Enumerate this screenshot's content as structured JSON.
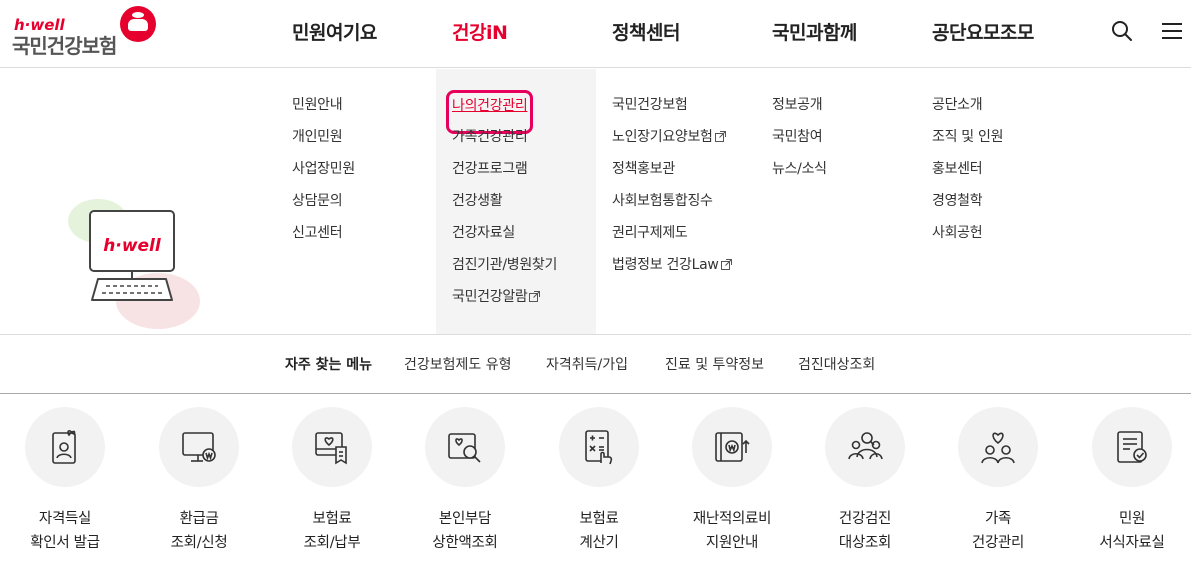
{
  "logo": {
    "hwell": "h·well",
    "text": "국민건강보험"
  },
  "gnb": [
    {
      "label": "민원여기요"
    },
    {
      "label": "건강iN"
    },
    {
      "label": "정책센터"
    },
    {
      "label": "국민과함께"
    },
    {
      "label": "공단요모조모"
    }
  ],
  "mega": {
    "col1": [
      "민원안내",
      "개인민원",
      "사업장민원",
      "상담문의",
      "신고센터"
    ],
    "col2": [
      "나의건강관리",
      "가족건강관리",
      "건강프로그램",
      "건강생활",
      "건강자료실",
      "검진기관/병원찾기",
      "국민건강알람"
    ],
    "col3": [
      "국민건강보험",
      "노인장기요양보험",
      "정책홍보관",
      "사회보험통합징수",
      "권리구제제도",
      "법령정보 건강Law"
    ],
    "col4": [
      "정보공개",
      "국민참여",
      "뉴스/소식"
    ],
    "col5": [
      "공단소개",
      "조직 및 인원",
      "홍보센터",
      "경영철학",
      "사회공헌"
    ],
    "illustration_text": "h·well"
  },
  "frequent": {
    "title": "자주 찾는 메뉴",
    "links": [
      "건강보험제도 유형",
      "자격취득/가입",
      "진료 및 투약정보",
      "검진대상조회"
    ]
  },
  "quick": [
    {
      "line1": "자격득실",
      "line2": "확인서 발급",
      "icon": "certificate-icon"
    },
    {
      "line1": "환급금",
      "line2": "조회/신청",
      "icon": "refund-monitor-icon"
    },
    {
      "line1": "보험료",
      "line2": "조회/납부",
      "icon": "premium-payment-icon"
    },
    {
      "line1": "본인부담",
      "line2": "상한액조회",
      "icon": "search-heart-icon"
    },
    {
      "line1": "보험료",
      "line2": "계산기",
      "icon": "calculator-icon"
    },
    {
      "line1": "재난적의료비",
      "line2": "지원안내",
      "icon": "medical-support-icon"
    },
    {
      "line1": "건강검진",
      "line2": "대상조회",
      "icon": "checkup-people-icon"
    },
    {
      "line1": "가족",
      "line2": "건강관리",
      "icon": "family-health-icon"
    },
    {
      "line1": "민원",
      "line2": "서식자료실",
      "icon": "forms-icon"
    }
  ],
  "colors": {
    "accent": "#e6002d",
    "highlight_border": "#e6005c",
    "menu_bg": "#f4f4f4",
    "icon_circle": "#f2f2f2"
  }
}
